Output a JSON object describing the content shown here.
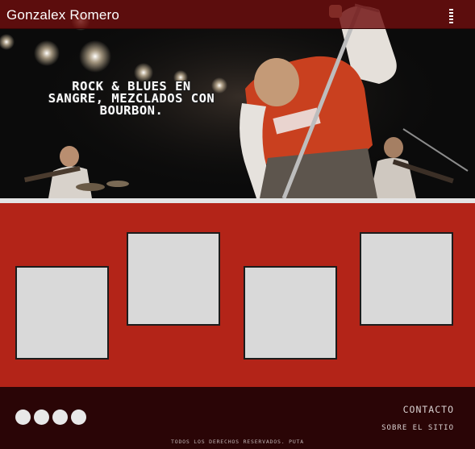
{
  "header": {
    "title": "Gonzalex Romero",
    "menu_icon": "hamburger-menu-icon"
  },
  "hero": {
    "tagline": "ROCK & BLUES EN SANGRE, MEZCLADOS CON BOURBON."
  },
  "gallery": {
    "tiles": [
      "",
      "",
      "",
      ""
    ]
  },
  "footer": {
    "social_icons": [
      "social-icon",
      "social-icon",
      "social-icon",
      "social-icon"
    ],
    "contact": "CONTACTO",
    "about": "SOBRE EL SITIO",
    "copyright": "TODOS LOS DERECHOS RESERVADOS. PUTA"
  },
  "colors": {
    "topbar": "#6e0e0e",
    "gallery_bg": "#b32418",
    "tile": "#d9d9d9",
    "footer_bg": "#2a0506"
  }
}
